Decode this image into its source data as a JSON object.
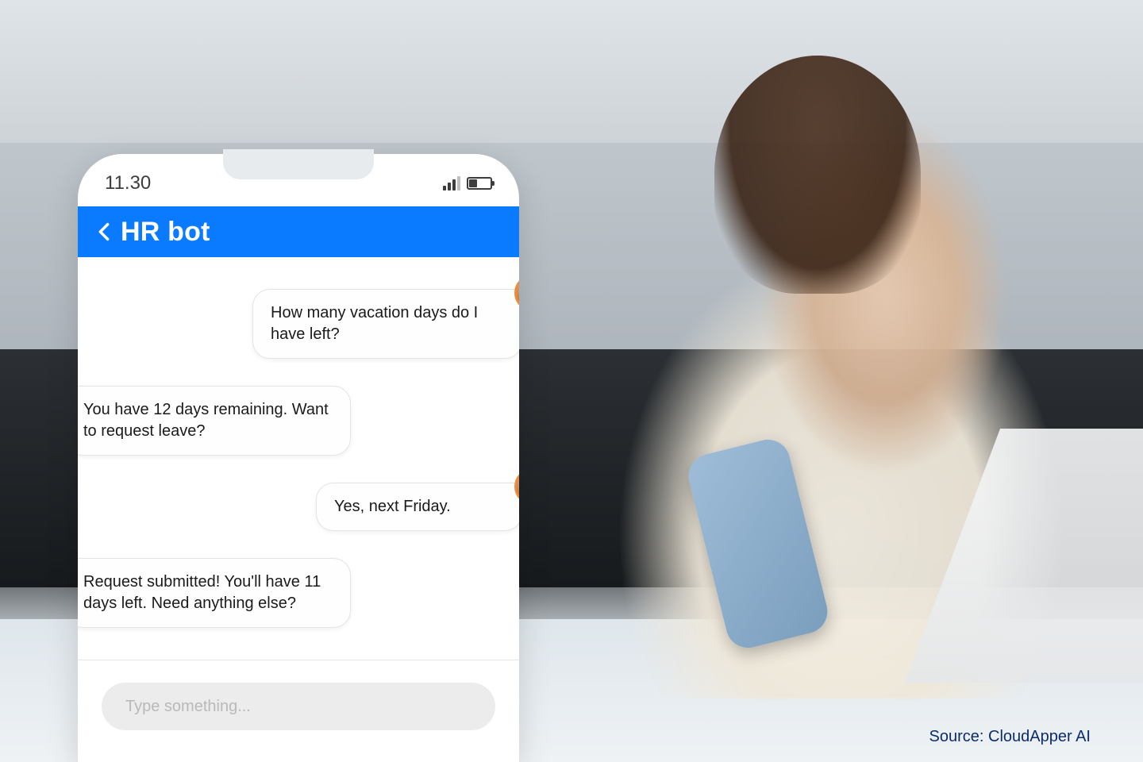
{
  "statusbar": {
    "time": "11.30",
    "signal_icon": "signal-icon",
    "battery_icon": "battery-icon"
  },
  "header": {
    "title": "HR bot",
    "back_icon": "chevron-left-icon"
  },
  "chat": {
    "messages": [
      {
        "role": "user",
        "text": "How many vacation days do I have left?"
      },
      {
        "role": "bot",
        "text": "You have 12 days remaining. Want to request leave?"
      },
      {
        "role": "user",
        "text": "Yes, next Friday."
      },
      {
        "role": "bot",
        "text": "Request submitted! You'll have 11 days left. Need anything else?"
      }
    ],
    "input_placeholder": "Type something..."
  },
  "avatars": {
    "user_icon": "user-avatar",
    "bot_icon": "chatbot-icon"
  },
  "credit": "Source: CloudApper AI",
  "colors": {
    "header_bg": "#0a7bff",
    "bot_avatar_bg": "#e23e12"
  }
}
